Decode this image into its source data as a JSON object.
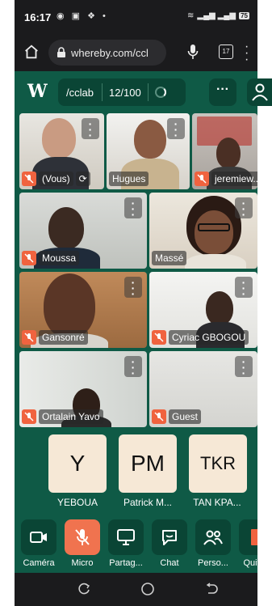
{
  "status_bar": {
    "time": "16:17",
    "battery": "75"
  },
  "browser": {
    "url": "whereby.com/ccl",
    "tab_count": "17"
  },
  "header": {
    "logo": "W",
    "room": "/cclab",
    "count": "12/100"
  },
  "tiles": [
    {
      "name": "(Vous)"
    },
    {
      "name": "Hugues"
    },
    {
      "name": "jeremiew..."
    },
    {
      "name": "Moussa"
    },
    {
      "name": "Massé"
    },
    {
      "name": "Gansonré"
    },
    {
      "name": "Cyriac GBOGOU"
    },
    {
      "name": "Ortalain Yavo"
    },
    {
      "name": "Guest"
    }
  ],
  "avatars": [
    {
      "initials": "Y",
      "name": "YEBOUA"
    },
    {
      "initials": "PM",
      "name": "Patrick M..."
    },
    {
      "initials": "TKR",
      "name": "TAN KPA..."
    }
  ],
  "controls": [
    {
      "label": "Caméra",
      "icon": "camera-icon"
    },
    {
      "label": "Micro",
      "icon": "mic-off-icon"
    },
    {
      "label": "Partag...",
      "icon": "screen-share-icon"
    },
    {
      "label": "Chat",
      "icon": "chat-icon"
    },
    {
      "label": "Perso...",
      "icon": "people-icon"
    },
    {
      "label": "Quitter",
      "icon": "leave-icon"
    }
  ],
  "colors": {
    "app_bg": "#0f5a46",
    "accent": "#f0633f",
    "avatar_bg": "#f6e8d6"
  }
}
